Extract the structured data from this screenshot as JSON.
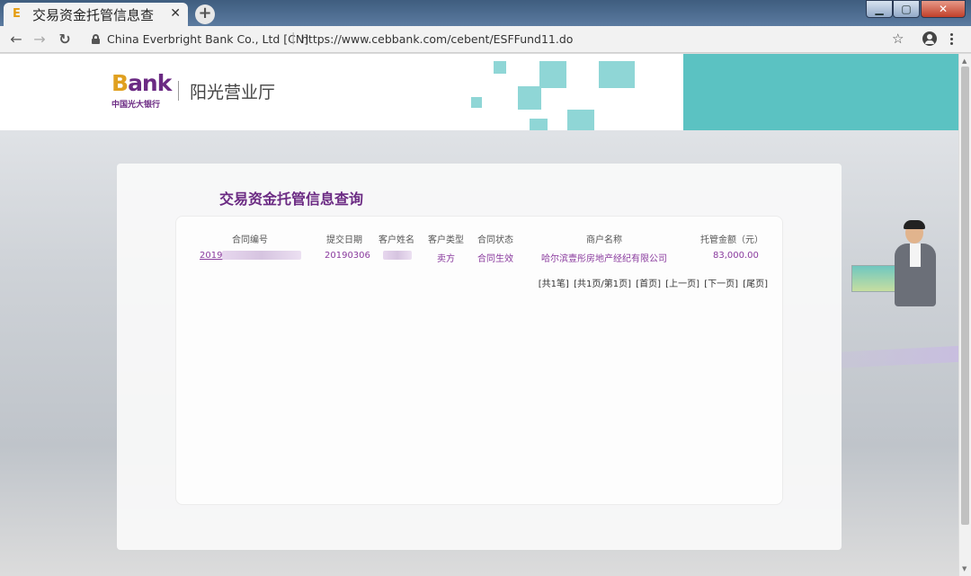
{
  "browser": {
    "tab_title": "交易资金托管信息查",
    "tab_favicon": "E",
    "site_name": "China Everbright Bank Co., Ltd [CN]",
    "url": "https://www.cebbank.com/cebent/ESFFund11.do"
  },
  "header": {
    "logo_text": "Bank",
    "logo_cn": "中国光大银行",
    "title": "阳光营业厅",
    "accent_color": "#5bc2c2",
    "brand_color": "#6b2a83"
  },
  "panel": {
    "title": "交易资金托管信息查询",
    "columns": [
      "合同编号",
      "提交日期",
      "客户姓名",
      "客户类型",
      "合同状态",
      "商户名称",
      "托管金额（元）"
    ],
    "rows": [
      {
        "contract_no_prefix": "2019",
        "submit_date": "20190306",
        "customer_type": "卖方",
        "status": "合同生效",
        "merchant": "哈尔滨壹彤房地产经纪有限公司",
        "amount": "83,000.00"
      }
    ],
    "pager": {
      "total": "[共1笔]",
      "page_info": "[共1页/第1页]",
      "first": "[首页]",
      "prev": "[上一页]",
      "next": "[下一页]",
      "last": "[尾页]"
    }
  }
}
